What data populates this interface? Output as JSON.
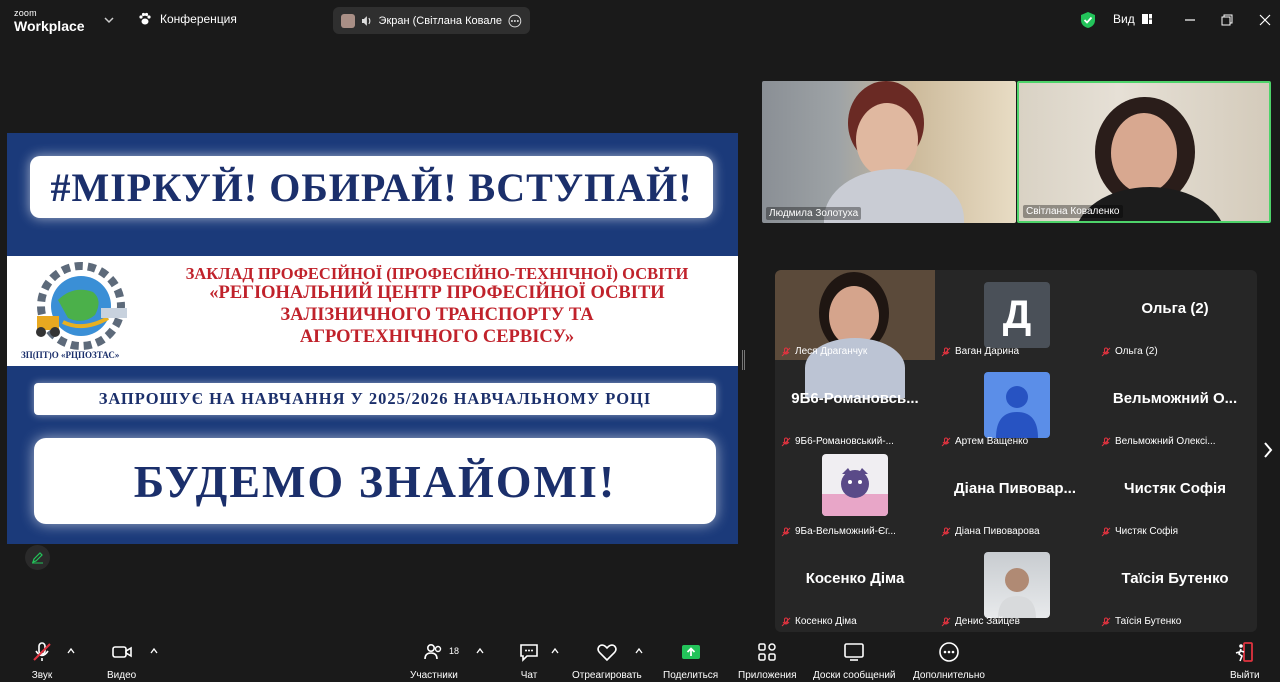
{
  "topbar": {
    "logo_small": "zoom",
    "logo_big": "Workplace",
    "meeting_label": "Конференция",
    "screen_share_label": "Экран (Світлана Коваленко)",
    "view_label": "Вид"
  },
  "slide": {
    "headline": "#МІРКУЙ! ОБИРАЙ! ВСТУПАЙ!",
    "org_line1": "ЗАКЛАД ПРОФЕСІЙНОЇ (ПРОФЕСІЙНО-ТЕХНІЧНОЇ) ОСВІТИ",
    "org_line2": "«РЕГІОНАЛЬНИЙ ЦЕНТР ПРОФЕСІЙНОЇ ОСВІТИ",
    "org_line3": "ЗАЛІЗНИЧНОГО ТРАНСПОРТУ ТА",
    "org_line4": "АГРОТЕХНІЧНОГО СЕРВІСУ»",
    "emblem_caption": "ЗП(ПТ)О «РЦПОЗТАС»",
    "invite": "ЗАПРОШУЄ НА НАВЧАННЯ У 2025/2026 НАВЧАЛЬНОМУ РОЦІ",
    "closing": "БУДЕМО ЗНАЙОМІ!"
  },
  "speakers": [
    {
      "name": "Людмила Золотуха"
    },
    {
      "name": "Світлана Коваленко"
    }
  ],
  "gallery": [
    {
      "label": "Леся Драганчук",
      "display": ""
    },
    {
      "label": "Ваган Дарина",
      "display": "",
      "avatar_letter": "Д"
    },
    {
      "label": "Ольга (2)",
      "display": "Ольга (2)"
    },
    {
      "label": "9Б6-Романовський-...",
      "display": "9Б6-Романовсь..."
    },
    {
      "label": "Артем Ващенко",
      "display": ""
    },
    {
      "label": "Вельможний Олексі...",
      "display": "Вельможний О..."
    },
    {
      "label": "9Ба-Вельможний-Єг...",
      "display": ""
    },
    {
      "label": "Діана Пивоварова",
      "display": "Діана Пивовар..."
    },
    {
      "label": "Чистяк Софія",
      "display": "Чистяк Софія"
    },
    {
      "label": "Косенко Діма",
      "display": "Косенко Діма"
    },
    {
      "label": "Денис Зайцев",
      "display": ""
    },
    {
      "label": "Таїсія Бутенко",
      "display": "Таїсія Бутенко"
    }
  ],
  "toolbar": {
    "audio": "Звук",
    "video": "Видео",
    "participants": "Участники",
    "participants_count": "18",
    "chat": "Чат",
    "react": "Отреагировать",
    "share": "Поделиться",
    "apps": "Приложения",
    "whiteboards": "Доски сообщений",
    "more": "Дополнительно",
    "leave": "Выйти"
  },
  "colors": {
    "accent_green": "#4ed36a",
    "share_green": "#23c35a",
    "leave_red": "#e0333f",
    "slide_blue": "#1b3a7a",
    "slide_red": "#c0222b"
  }
}
